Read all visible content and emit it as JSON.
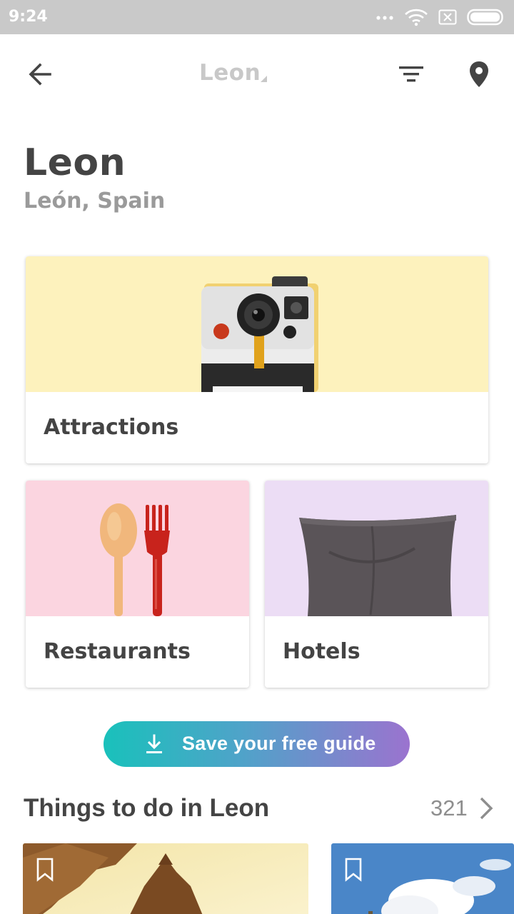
{
  "status_bar": {
    "time": "9:24",
    "icons": [
      "dots-icon",
      "wifi-icon",
      "no-sim-icon",
      "battery-icon"
    ]
  },
  "app_bar": {
    "title": "Leon",
    "icons": [
      "back-arrow-icon",
      "filter-icon",
      "map-pin-icon"
    ]
  },
  "header": {
    "title": "Leon",
    "subtitle": "León, Spain"
  },
  "categories": [
    {
      "label": "Attractions",
      "image": "instant-camera",
      "bg": "#fdf2bd"
    },
    {
      "label": "Restaurants",
      "image": "spoon-and-fork",
      "bg": "#fbd5e0"
    },
    {
      "label": "Hotels",
      "image": "pillow",
      "bg": "#ecddf5"
    }
  ],
  "save_button": {
    "label": "Save your free guide",
    "icon": "download-icon"
  },
  "things_to_do": {
    "title": "Things to do in Leon",
    "count": "321",
    "more_icon": "chevron-right-icon"
  },
  "colors": {
    "text_primary": "#444444",
    "text_secondary": "#9a9a9a",
    "gradient_start": "#19c1bb",
    "gradient_end": "#9b73cf",
    "status_bar": "#c9c9c9"
  }
}
